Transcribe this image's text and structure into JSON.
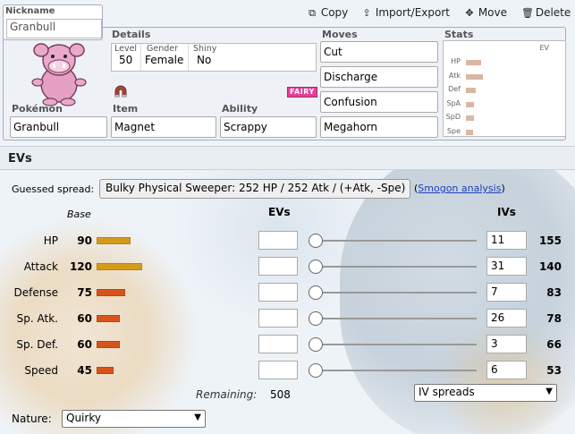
{
  "nickname": {
    "label": "Nickname",
    "value": "Granbull"
  },
  "toolbar": {
    "copy": "Copy",
    "import_export": "Import/Export",
    "move": "Move",
    "delete": "Delete"
  },
  "details": {
    "title": "Details",
    "level_label": "Level",
    "level": "50",
    "gender_label": "Gender",
    "gender": "Female",
    "shiny_label": "Shiny",
    "shiny": "No"
  },
  "type_badge": "FAIRY",
  "pokemon": {
    "label": "Pokémon",
    "value": "Granbull"
  },
  "item": {
    "label": "Item",
    "value": "Magnet"
  },
  "ability": {
    "label": "Ability",
    "value": "Scrappy"
  },
  "moves": {
    "label": "Moves",
    "list": [
      "Cut",
      "Discharge",
      "Confusion",
      "Megahorn"
    ]
  },
  "stats_summary": {
    "label": "Stats",
    "ev_label": "EV",
    "rows": [
      {
        "label": "HP",
        "fill": 0.15
      },
      {
        "label": "Atk",
        "fill": 0.17
      },
      {
        "label": "Def",
        "fill": 0.1
      },
      {
        "label": "SpA",
        "fill": 0.08
      },
      {
        "label": "SpD",
        "fill": 0.08
      },
      {
        "label": "Spe",
        "fill": 0.07
      }
    ]
  },
  "evs": {
    "title": "EVs",
    "guessed_label": "Guessed spread:",
    "guessed_value": "Bulky Physical Sweeper: 252 HP / 252 Atk / (+Atk, -Spe)",
    "smogon_prefix": "(",
    "smogon_link": "Smogon analysis",
    "smogon_suffix": ")",
    "headers": {
      "base": "Base",
      "evs": "EVs",
      "ivs": "IVs"
    },
    "stats": [
      {
        "label": "HP",
        "base": "90",
        "iv": "11",
        "total": "155",
        "ev": "",
        "slider": 0,
        "color": "#d69a1a"
      },
      {
        "label": "Attack",
        "base": "120",
        "iv": "31",
        "total": "140",
        "ev": "",
        "slider": 0,
        "color": "#d69a1a"
      },
      {
        "label": "Defense",
        "base": "75",
        "iv": "7",
        "total": "83",
        "ev": "",
        "slider": 0,
        "color": "#d8531a"
      },
      {
        "label": "Sp. Atk.",
        "base": "60",
        "iv": "26",
        "total": "78",
        "ev": "",
        "slider": 0,
        "color": "#d8531a"
      },
      {
        "label": "Sp. Def.",
        "base": "60",
        "iv": "3",
        "total": "66",
        "ev": "",
        "slider": 0,
        "color": "#d8531a"
      },
      {
        "label": "Speed",
        "base": "45",
        "iv": "6",
        "total": "53",
        "ev": "",
        "slider": 0,
        "color": "#d8531a"
      }
    ],
    "remaining_label": "Remaining:",
    "remaining_value": "508",
    "iv_spreads": "IV spreads",
    "nature_label": "Nature:",
    "nature_value": "Quirky"
  }
}
